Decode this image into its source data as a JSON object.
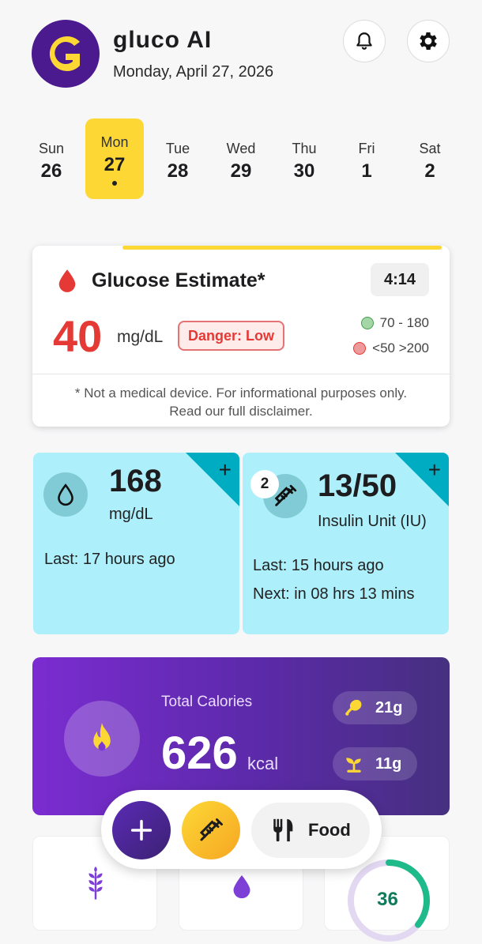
{
  "header": {
    "app_name": "gluco AI",
    "date": "Monday, April 27, 2026",
    "logo_letter": "G"
  },
  "week": [
    {
      "name": "Sun",
      "num": "26",
      "active": false
    },
    {
      "name": "Mon",
      "num": "27",
      "active": true
    },
    {
      "name": "Tue",
      "num": "28",
      "active": false
    },
    {
      "name": "Wed",
      "num": "29",
      "active": false
    },
    {
      "name": "Thu",
      "num": "30",
      "active": false
    },
    {
      "name": "Fri",
      "num": "1",
      "active": false
    },
    {
      "name": "Sat",
      "num": "2",
      "active": false
    }
  ],
  "glucose_card": {
    "title": "Glucose Estimate*",
    "timer": "4:14",
    "value": "40",
    "unit": "mg/dL",
    "status": "Danger: Low",
    "range_normal": "70 - 180",
    "range_danger": "<50 >200",
    "disclaimer_line1": "* Not a medical device. For informational purposes only.",
    "disclaimer_line2": "Read our full disclaimer.",
    "progress_fraction": 0.78,
    "colors": {
      "danger": "#e53935",
      "accent": "#fdd835",
      "normal_dot": "#a5d6a7",
      "danger_dot": "#ef9a9a"
    }
  },
  "glucose_tile": {
    "value": "168",
    "unit": "mg/dL",
    "last": "Last: 17 hours ago",
    "plus": "+"
  },
  "insulin_tile": {
    "badge": "2",
    "value": "13/50",
    "unit": "Insulin Unit (IU)",
    "last": "Last: 15 hours ago",
    "next": "Next: in 08 hrs 13 mins",
    "plus": "+"
  },
  "calories": {
    "label": "Total Calories",
    "value": "626",
    "unit": "kcal",
    "protein": "21g",
    "carbs": "11g"
  },
  "fab": {
    "add_label": "+",
    "food_label": "Food"
  },
  "bottom_tiles": {
    "progress_value": "36"
  },
  "icons": [
    "bell-icon",
    "gear-icon",
    "blood-drop-icon",
    "water-drop-icon",
    "syringe-icon",
    "flame-icon",
    "drumstick-icon",
    "sprout-icon",
    "plus-icon",
    "utensils-icon",
    "wheat-icon",
    "drop-icon"
  ]
}
